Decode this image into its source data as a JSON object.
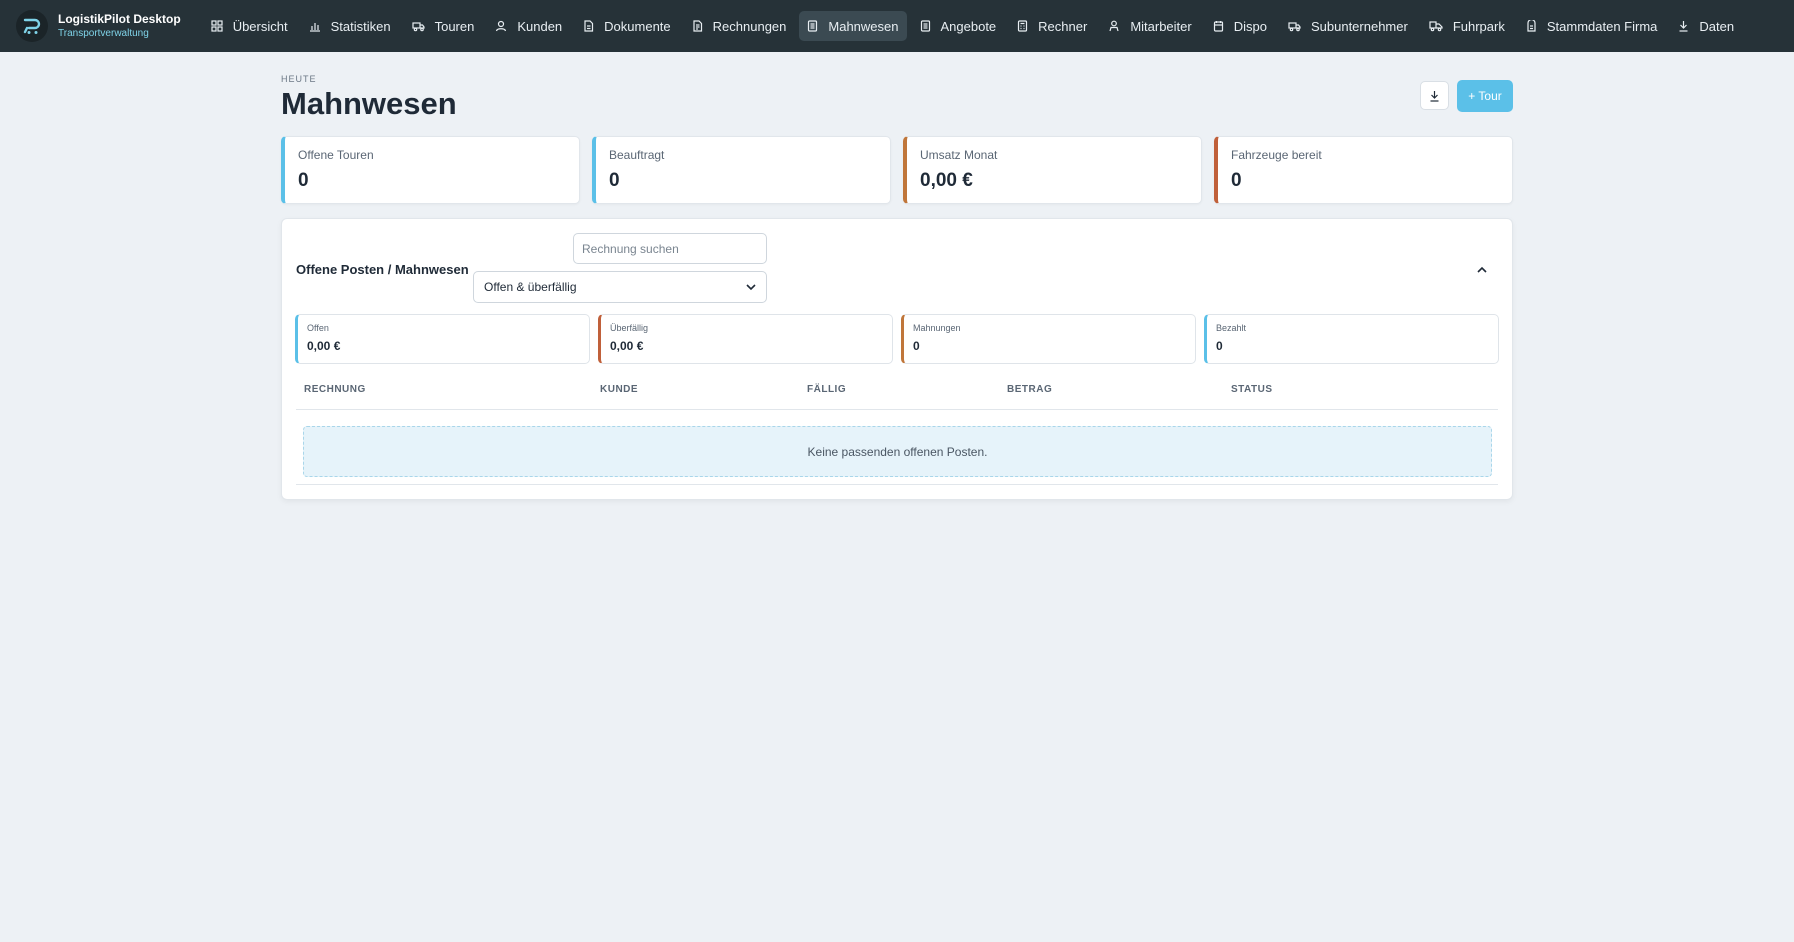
{
  "brand": {
    "title": "LogistikPilot Desktop",
    "subtitle": "Transportverwaltung"
  },
  "nav": [
    {
      "label": "Übersicht",
      "icon": "grid-icon"
    },
    {
      "label": "Statistiken",
      "icon": "bar-chart-icon"
    },
    {
      "label": "Touren",
      "icon": "truck-icon"
    },
    {
      "label": "Kunden",
      "icon": "user-icon"
    },
    {
      "label": "Dokumente",
      "icon": "document-icon"
    },
    {
      "label": "Rechnungen",
      "icon": "invoice-icon"
    },
    {
      "label": "Mahnwesen",
      "icon": "reminder-document-icon",
      "active": true
    },
    {
      "label": "Angebote",
      "icon": "list-document-icon"
    },
    {
      "label": "Rechner",
      "icon": "calculator-icon"
    },
    {
      "label": "Mitarbeiter",
      "icon": "person-icon"
    },
    {
      "label": "Dispo",
      "icon": "calendar-icon"
    },
    {
      "label": "Subunternehmer",
      "icon": "truck-icon"
    },
    {
      "label": "Fuhrpark",
      "icon": "vehicle-icon"
    },
    {
      "label": "Stammdaten Firma",
      "icon": "building-icon"
    },
    {
      "label": "Daten",
      "icon": "download-icon"
    }
  ],
  "header": {
    "eyebrow": "HEUTE",
    "title": "Mahnwesen",
    "tour_button": "+ Tour"
  },
  "stats": [
    {
      "label": "Offene Touren",
      "value": "0",
      "color": "#5bc0e8"
    },
    {
      "label": "Beauftragt",
      "value": "0",
      "color": "#5bc0e8"
    },
    {
      "label": "Umsatz Monat",
      "value": "0,00 €",
      "color": "#c0763a"
    },
    {
      "label": "Fahrzeuge bereit",
      "value": "0",
      "color": "#c0603a"
    }
  ],
  "panel": {
    "title": "Offene Posten / Mahnwesen",
    "search_placeholder": "Rechnung suchen",
    "filter_selected": "Offen & überfällig",
    "summary": [
      {
        "label": "Offen",
        "value": "0,00 €",
        "color": "#5bc0e8"
      },
      {
        "label": "Überfällig",
        "value": "0,00 €",
        "color": "#c0603a"
      },
      {
        "label": "Mahnungen",
        "value": "0",
        "color": "#c0763a"
      },
      {
        "label": "Bezahlt",
        "value": "0",
        "color": "#5bc0e8"
      }
    ],
    "columns": [
      "RECHNUNG",
      "KUNDE",
      "FÄLLIG",
      "BETRAG",
      "STATUS"
    ],
    "empty_message": "Keine passenden offenen Posten."
  }
}
